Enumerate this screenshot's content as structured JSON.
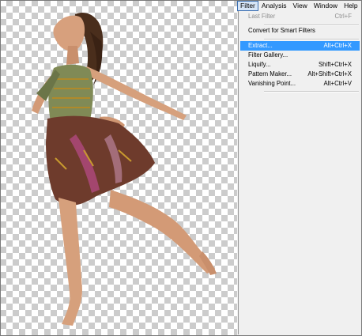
{
  "menubar": {
    "items": [
      {
        "label": "Filter",
        "active": true
      },
      {
        "label": "Analysis"
      },
      {
        "label": "View"
      },
      {
        "label": "Window"
      },
      {
        "label": "Help"
      }
    ]
  },
  "filter_menu": {
    "last_filter": {
      "label": "Last Filter",
      "shortcut": "Ctrl+F"
    },
    "convert_smart": {
      "label": "Convert for Smart Filters"
    },
    "extract": {
      "label": "Extract...",
      "shortcut": "Alt+Ctrl+X"
    },
    "filter_gallery": {
      "label": "Filter Gallery..."
    },
    "liquify": {
      "label": "Liquify...",
      "shortcut": "Shift+Ctrl+X"
    },
    "pattern_maker": {
      "label": "Pattern Maker...",
      "shortcut": "Alt+Shift+Ctrl+X"
    },
    "vanishing_point": {
      "label": "Vanishing Point...",
      "shortcut": "Alt+Ctrl+V"
    }
  },
  "colors": {
    "highlight": "#3399ff",
    "menu_bg": "#f0f0f0",
    "transparency_checker": "#cccccc"
  }
}
